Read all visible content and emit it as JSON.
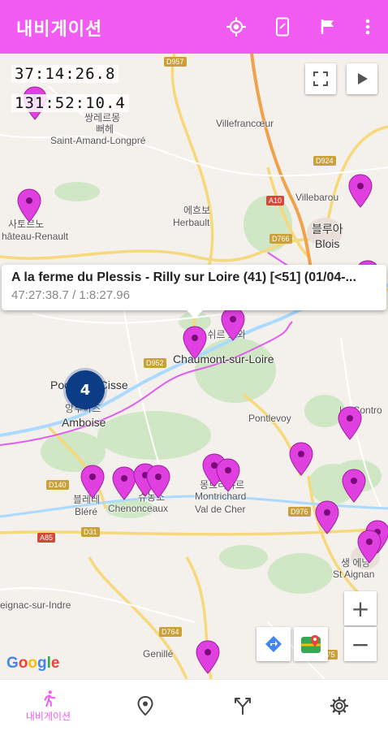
{
  "app_bar": {
    "title": "내비게이션",
    "background": "#f15bf1",
    "actions": [
      "my-location-icon",
      "phone-icon",
      "flag-icon",
      "more-vert-icon"
    ]
  },
  "map": {
    "coord_lat": "37:14:26.8",
    "coord_lon": "131:52:10.4",
    "buttons": [
      "fullscreen-icon",
      "play-icon"
    ],
    "places": {
      "saint_amand": "Saint-Amand-Longpré",
      "villefrancoeur": "Villefrancœur",
      "villebarou": "Villebarou",
      "blois_ko": "블루아",
      "blois": "Blois",
      "herbault_ko": "에흐보",
      "herbault": "Herbault",
      "chateau_renault_ko": "사토르노",
      "chateau_renault": "hâteau-Renault",
      "chaumont_ko": "쇼몽 쉬르 르와",
      "chaumont": "Chaumont-sur-Loire",
      "amboise_ko": "앙부아즈",
      "amboise": "Amboise",
      "pocé": "Pocé-sur-Cisse",
      "pontlevoy": "Pontlevoy",
      "contres": "Le Contro",
      "blere_ko": "블레레",
      "blere": "Bléré",
      "chenonceaux_ko": "슈농소",
      "chenonceaux": "Chenonceaux",
      "montrichard_ko": "몽트리샤르",
      "montrichard": "Montrichard",
      "val_de_cher": "Val de Cher",
      "st_aignan_ko": "생 에냥",
      "st_aignan": "St Aignan",
      "ligueil": "eignac-sur-Indre",
      "genille": "Genillé",
      "top_town": "쌍레르몽\n뻐헤"
    },
    "roads": [
      "D957",
      "D924",
      "A10",
      "D766",
      "D952",
      "D140",
      "D976",
      "A85",
      "D31",
      "D764",
      "D675"
    ],
    "cluster_count": "4",
    "info_window": {
      "title": "A la ferme du Plessis - Rilly sur Loire (41) [<51] (01/04-...",
      "subtitle": "47:27:38.7 / 1:8:27.96"
    },
    "attribution": "Google",
    "zoom_in": "+",
    "zoom_out": "−",
    "map_tools": [
      "directions-icon",
      "google-maps-icon"
    ]
  },
  "bottom_nav": {
    "items": [
      {
        "icon": "walk-icon",
        "label": "내비게이션",
        "active": true
      },
      {
        "icon": "location-pin-icon",
        "label": "",
        "active": false
      },
      {
        "icon": "fork-icon",
        "label": "",
        "active": false
      },
      {
        "icon": "settings-icon",
        "label": "",
        "active": false
      }
    ],
    "accent": "#f15bf1"
  }
}
